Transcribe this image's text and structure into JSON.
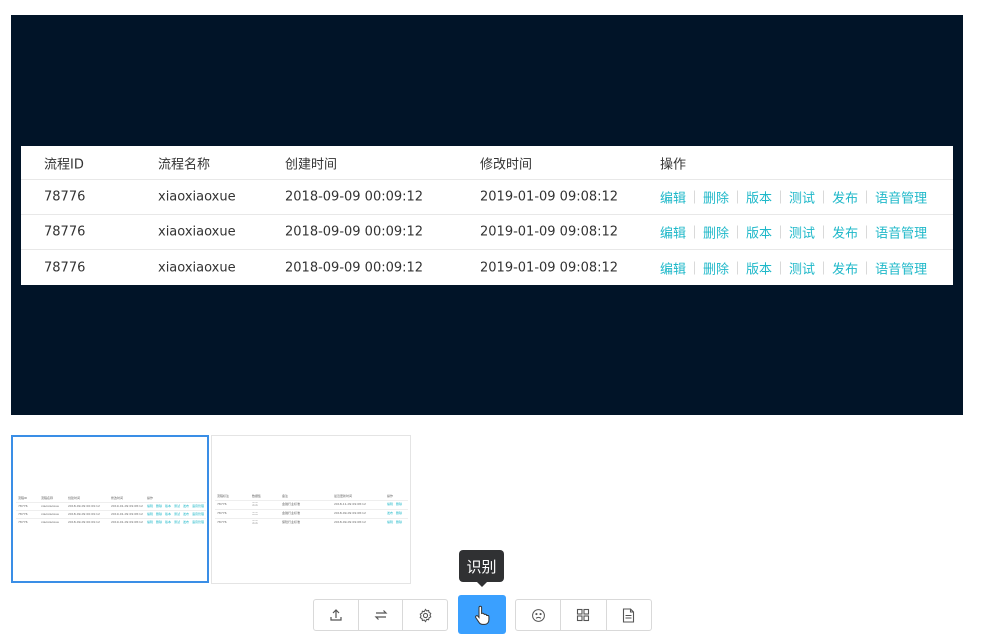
{
  "table": {
    "headers": [
      "流程ID",
      "流程名称",
      "创建时间",
      "修改时间",
      "操作"
    ],
    "rows": [
      [
        "78776",
        "xiaoxiaoxue",
        "2018-09-09 00:09:12",
        "2019-01-09 09:08:12"
      ],
      [
        "78776",
        "xiaoxiaoxue",
        "2018-09-09 00:09:12",
        "2019-01-09 09:08:12"
      ],
      [
        "78776",
        "xiaoxiaoxue",
        "2018-09-09 00:09:12",
        "2019-01-09 09:08:12"
      ]
    ],
    "actions": [
      "编辑",
      "删除",
      "版本",
      "测试",
      "发布",
      "语音管理"
    ]
  },
  "thumbnails": {
    "second": {
      "headers": [
        "流程标注",
        "数据集",
        "备注",
        "最近更新时间",
        "操作"
      ],
      "rows": [
        [
          "78776",
          "三三",
          "金融行业标准",
          "2018-11-09 09:08:12",
          "编辑",
          "删除"
        ],
        [
          "78776",
          "二二",
          "金融行业标准",
          "2018-09-09 09:08:12",
          "发布",
          "删除"
        ],
        [
          "78776",
          "三三",
          "保险行业标准",
          "2018-09-09 09:08:12",
          "编辑",
          "删除"
        ]
      ]
    }
  },
  "tooltip": {
    "label": "识别"
  },
  "toolbar": {
    "left_icons": [
      "upload-icon",
      "swap-icon",
      "settings-icon"
    ],
    "primary_icon": "pointer-hand-icon",
    "right_icons": [
      "face-icon",
      "grid-icon",
      "document-icon"
    ]
  },
  "colors": {
    "canvas": "#011428",
    "link": "#1fb8c9",
    "primary": "#3aa0ff",
    "selected_border": "#3a8ee6"
  }
}
